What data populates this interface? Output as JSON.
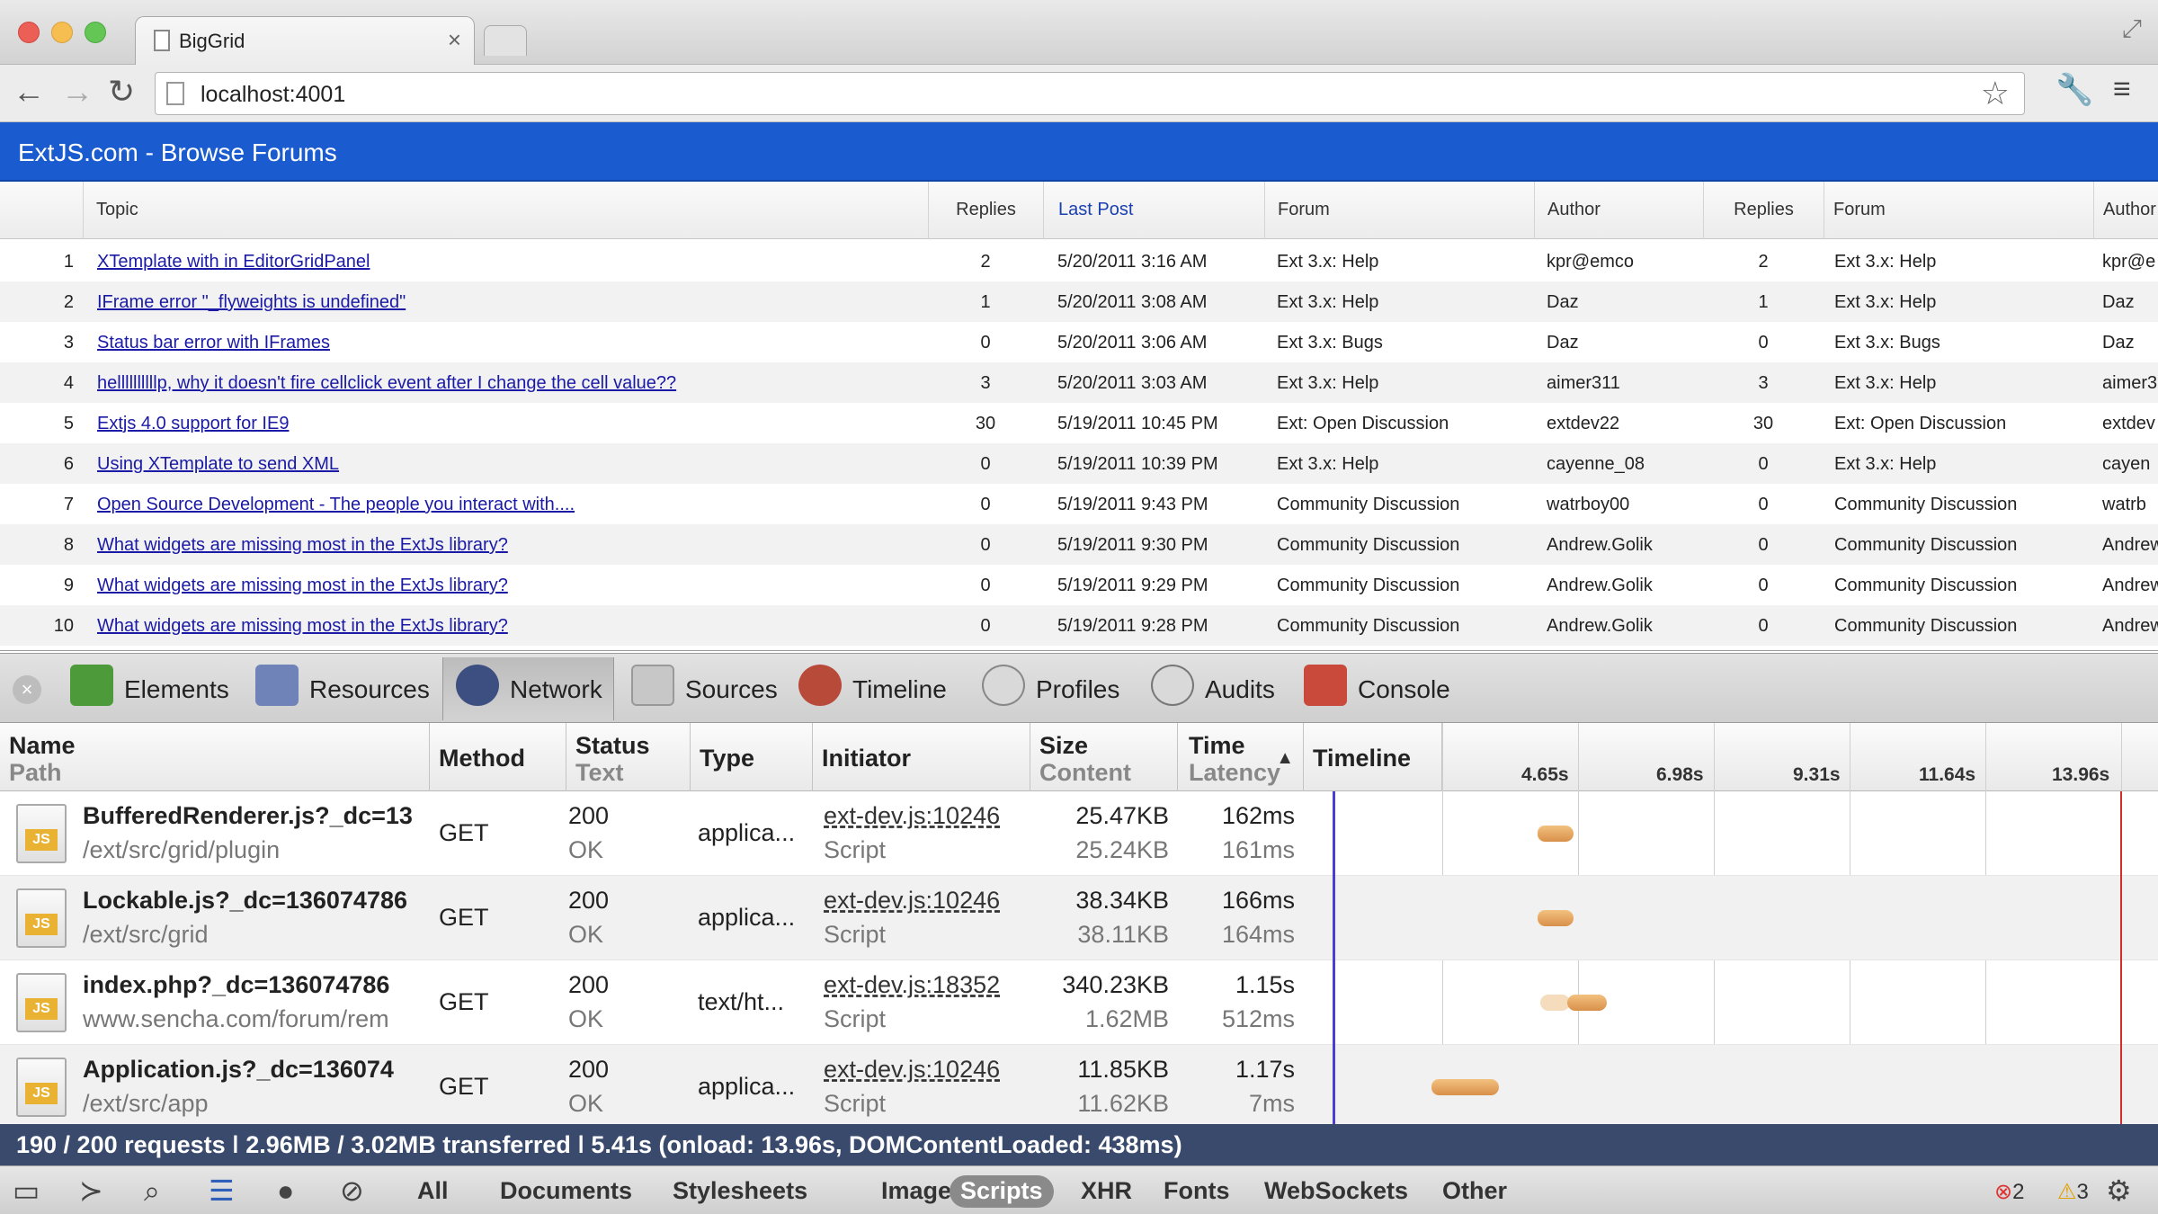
{
  "browser": {
    "tab_title": "BigGrid",
    "url": "localhost:4001"
  },
  "app": {
    "header_title": "ExtJS.com - Browse Forums"
  },
  "grid": {
    "columns": [
      "Topic",
      "Replies",
      "Last Post",
      "Forum",
      "Author",
      "Replies",
      "Forum",
      "Author"
    ],
    "rows": [
      {
        "n": "1",
        "topic": "XTemplate with in EditorGridPanel",
        "replies": "2",
        "last_post": "5/20/2011 3:16 AM",
        "forum": "Ext 3.x: Help",
        "author": "kpr@emco",
        "replies2": "2",
        "forum2": "Ext 3.x: Help",
        "author2": "kpr@e"
      },
      {
        "n": "2",
        "topic": "IFrame error \"_flyweights is undefined\"",
        "replies": "1",
        "last_post": "5/20/2011 3:08 AM",
        "forum": "Ext 3.x: Help",
        "author": "Daz",
        "replies2": "1",
        "forum2": "Ext 3.x: Help",
        "author2": "Daz"
      },
      {
        "n": "3",
        "topic": "Status bar error with IFrames",
        "replies": "0",
        "last_post": "5/20/2011 3:06 AM",
        "forum": "Ext 3.x: Bugs",
        "author": "Daz",
        "replies2": "0",
        "forum2": "Ext 3.x: Bugs",
        "author2": "Daz"
      },
      {
        "n": "4",
        "topic": "hellllllllllp, why it doesn't fire cellclick event after I change the cell value??",
        "replies": "3",
        "last_post": "5/20/2011 3:03 AM",
        "forum": "Ext 3.x: Help",
        "author": "aimer311",
        "replies2": "3",
        "forum2": "Ext 3.x: Help",
        "author2": "aimer3"
      },
      {
        "n": "5",
        "topic": "Extjs 4.0 support for IE9",
        "replies": "30",
        "last_post": "5/19/2011 10:45 PM",
        "forum": "Ext: Open Discussion",
        "author": "extdev22",
        "replies2": "30",
        "forum2": "Ext: Open Discussion",
        "author2": "extdev"
      },
      {
        "n": "6",
        "topic": "Using XTemplate to send XML",
        "replies": "0",
        "last_post": "5/19/2011 10:39 PM",
        "forum": "Ext 3.x: Help",
        "author": "cayenne_08",
        "replies2": "0",
        "forum2": "Ext 3.x: Help",
        "author2": "cayen"
      },
      {
        "n": "7",
        "topic": "Open Source Development - The people you interact with....",
        "replies": "0",
        "last_post": "5/19/2011 9:43 PM",
        "forum": "Community Discussion",
        "author": "watrboy00",
        "replies2": "0",
        "forum2": "Community Discussion",
        "author2": "watrb"
      },
      {
        "n": "8",
        "topic": "What widgets are missing most in the ExtJs library?",
        "replies": "0",
        "last_post": "5/19/2011 9:30 PM",
        "forum": "Community Discussion",
        "author": "Andrew.Golik",
        "replies2": "0",
        "forum2": "Community Discussion",
        "author2": "Andrew"
      },
      {
        "n": "9",
        "topic": "What widgets are missing most in the ExtJs library?",
        "replies": "0",
        "last_post": "5/19/2011 9:29 PM",
        "forum": "Community Discussion",
        "author": "Andrew.Golik",
        "replies2": "0",
        "forum2": "Community Discussion",
        "author2": "Andrew"
      },
      {
        "n": "10",
        "topic": "What widgets are missing most in the ExtJs library?",
        "replies": "0",
        "last_post": "5/19/2011 9:28 PM",
        "forum": "Community Discussion",
        "author": "Andrew.Golik",
        "replies2": "0",
        "forum2": "Community Discussion",
        "author2": "Andrew"
      }
    ]
  },
  "devtools": {
    "tabs": [
      "Elements",
      "Resources",
      "Network",
      "Sources",
      "Timeline",
      "Profiles",
      "Audits",
      "Console"
    ],
    "selected_tab": "Network",
    "network": {
      "headers": {
        "name": "Name",
        "path": "Path",
        "method": "Method",
        "status": "Status",
        "text": "Text",
        "type": "Type",
        "initiator": "Initiator",
        "size": "Size",
        "content": "Content",
        "time": "Time",
        "latency": "Latency",
        "timeline": "Timeline"
      },
      "ticks": [
        "4.65s",
        "6.98s",
        "9.31s",
        "11.64s",
        "13.96s"
      ],
      "rows": [
        {
          "name": "BufferedRenderer.js?_dc=13",
          "path": "/ext/src/grid/plugin",
          "method": "GET",
          "status": "200",
          "text": "OK",
          "type": "applica...",
          "initiator": "ext-dev.js:10246",
          "initiator_type": "Script",
          "size": "25.47KB",
          "content": "25.24KB",
          "time": "162ms",
          "latency": "161ms",
          "icon": "js-file-icon",
          "start_s": 3.95,
          "latency_s": 0.161,
          "duration_s": 0.162
        },
        {
          "name": "Lockable.js?_dc=136074786",
          "path": "/ext/src/grid",
          "method": "GET",
          "status": "200",
          "text": "OK",
          "type": "applica...",
          "initiator": "ext-dev.js:10246",
          "initiator_type": "Script",
          "size": "38.34KB",
          "content": "38.11KB",
          "time": "166ms",
          "latency": "164ms",
          "icon": "js-file-icon",
          "start_s": 3.95,
          "latency_s": 0.164,
          "duration_s": 0.166
        },
        {
          "name": "index.php?_dc=136074786",
          "path": "www.sencha.com/forum/rem",
          "method": "GET",
          "status": "200",
          "text": "OK",
          "type": "text/ht...",
          "initiator": "ext-dev.js:18352",
          "initiator_type": "Script",
          "size": "340.23KB",
          "content": "1.62MB",
          "time": "1.15s",
          "latency": "512ms",
          "icon": "js-file-icon",
          "start_s": 4.0,
          "latency_s": 0.512,
          "duration_s": 1.15
        },
        {
          "name": "Application.js?_dc=136074",
          "path": "/ext/src/app",
          "method": "GET",
          "status": "200",
          "text": "OK",
          "type": "applica...",
          "initiator": "ext-dev.js:10246",
          "initiator_type": "Script",
          "size": "11.85KB",
          "content": "11.62KB",
          "time": "1.17s",
          "latency": "7ms",
          "icon": "js-file-icon",
          "start_s": 2.13,
          "latency_s": 0.007,
          "duration_s": 1.17
        }
      ],
      "summary": "190 / 200 requests  ǀ  2.96MB / 3.02MB transferred  ǀ  5.41s (onload: 13.96s, DOMContentLoaded: 438ms)",
      "filters": [
        "All",
        "Documents",
        "Stylesheets",
        "Images",
        "Scripts",
        "XHR",
        "Fonts",
        "WebSockets",
        "Other"
      ],
      "selected_filter": "Scripts",
      "errors": "2",
      "warnings": "3"
    }
  },
  "colors": {
    "app_header": "#1a5ccf",
    "link": "#1a1aa6",
    "summary_bar": "#3a4a6c",
    "dom_content_loaded_line": "#4b3fd0",
    "onload_line": "#d22e2e",
    "timing_bar": "#e8a860"
  }
}
